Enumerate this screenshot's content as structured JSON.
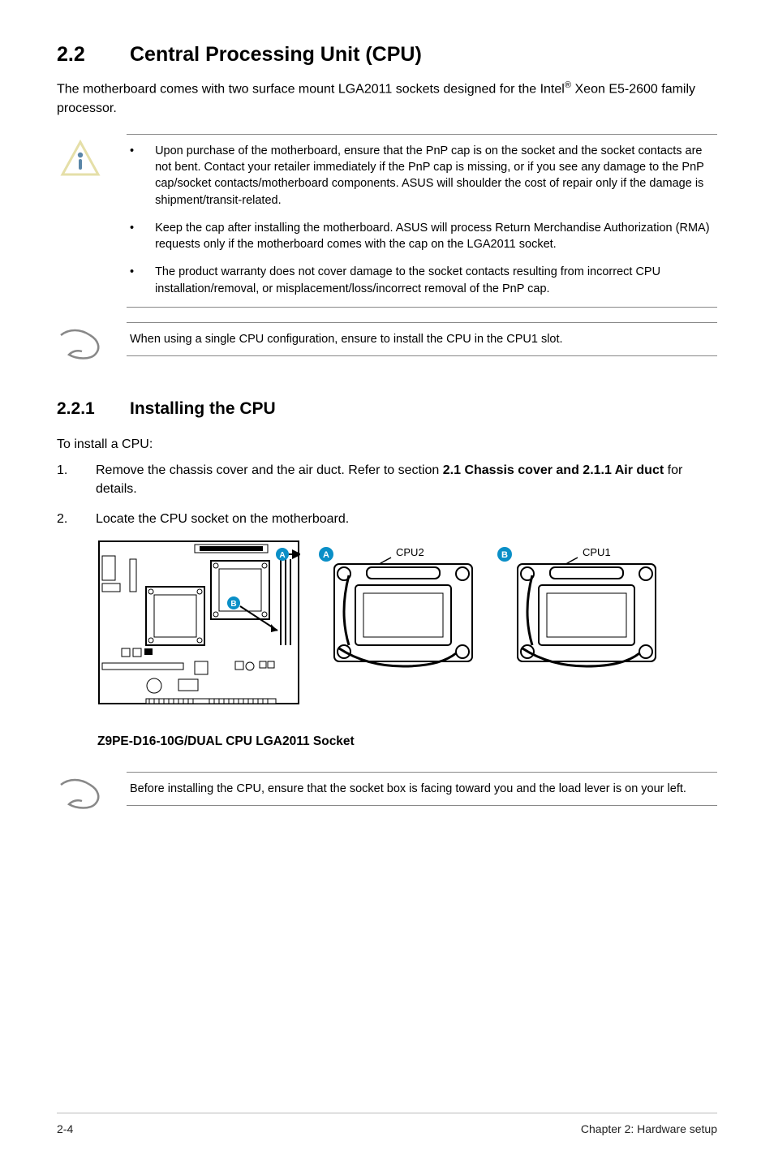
{
  "section": {
    "number": "2.2",
    "title": "Central Processing Unit (CPU)",
    "intro_a": "The motherboard comes with two surface mount LGA2011 sockets designed for the  Intel",
    "intro_sup": "®",
    "intro_b": " Xeon E5-2600 family processor."
  },
  "caution": {
    "items": [
      "Upon purchase of the motherboard, ensure that the PnP cap is on the socket and the socket contacts are not bent. Contact your retailer immediately if the PnP cap is missing, or if you see any damage to the PnP cap/socket contacts/motherboard components. ASUS will shoulder the cost of repair only if the damage is shipment/transit-related.",
      "Keep the cap after installing the motherboard. ASUS will process Return Merchandise Authorization (RMA) requests only if the motherboard comes with the cap on the LGA2011 socket.",
      "The product warranty does not cover damage to the socket contacts resulting from incorrect CPU installation/removal, or misplacement/loss/incorrect removal of the PnP cap."
    ]
  },
  "note1": "When using a single CPU configuration, ensure to install the CPU in the CPU1 slot.",
  "subsection": {
    "number": "2.2.1",
    "title": "Installing the CPU",
    "lead": "To install a CPU:",
    "steps": [
      {
        "no": "1.",
        "text_a": "Remove the chassis cover and the air duct. Refer to section ",
        "bold1": "2.1 Chassis cover and 2.1.1 Air duct",
        "text_b": " for details."
      },
      {
        "no": "2.",
        "text_a": "Locate the CPU socket on the motherboard.",
        "bold1": "",
        "text_b": ""
      }
    ]
  },
  "diagram": {
    "cpu2_label": "CPU2",
    "cpu1_label": "CPU1",
    "marker_a": "A",
    "marker_b": "B",
    "caption": "Z9PE-D16-10G/DUAL CPU LGA2011 Socket"
  },
  "note2": "Before installing the CPU, ensure that the socket box is facing toward you and the load lever is on your left.",
  "footer": {
    "page": "2-4",
    "chapter": "Chapter 2:  Hardware setup"
  }
}
